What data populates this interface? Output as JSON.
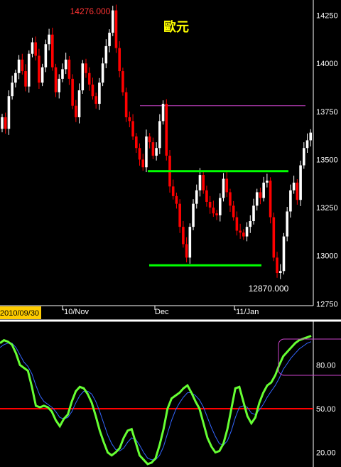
{
  "colors": {
    "background": "#000000",
    "up_candle": "#ffffff",
    "down_candle": "#ff0000",
    "support_resistance": "#00ff00",
    "target_line": "#cc44cc",
    "osc_main": "#66ff33",
    "osc_signal": "#3366ff",
    "osc_midline": "#ff0000",
    "date_box": "#ffcc00",
    "max_label": "#ff3333",
    "title": "#ffff00"
  },
  "chart_data": [
    {
      "type": "candlestick",
      "title": "歐元",
      "ylim": [
        12740,
        14330
      ],
      "y_ticks": [
        "14250",
        "14000",
        "13750",
        "13500",
        "13250",
        "13000",
        "12750"
      ],
      "x_ticks": [
        "'10/Nov",
        "Dec",
        "'11/Jan"
      ],
      "start_date_label": "2010/09/30",
      "max_label": "14276.000",
      "min_label": "12870.000",
      "resistance_level": 13440,
      "support_level": 12950,
      "target_level": 13780,
      "closes": [
        13720,
        13660,
        13830,
        13900,
        13950,
        14020,
        13960,
        13880,
        14050,
        14110,
        14040,
        13900,
        13980,
        14100,
        14150,
        13980,
        13850,
        13920,
        13970,
        14020,
        13920,
        13780,
        13720,
        13860,
        14000,
        13950,
        13890,
        13830,
        13790,
        13900,
        14000,
        14090,
        14160,
        14276,
        14080,
        13960,
        13850,
        13720,
        13700,
        13620,
        13560,
        13500,
        13460,
        13620,
        13590,
        13520,
        13560,
        13700,
        13790,
        13520,
        13360,
        13310,
        13270,
        13150,
        13060,
        12990,
        13150,
        13270,
        13340,
        13420,
        13340,
        13280,
        13250,
        13220,
        13210,
        13300,
        13400,
        13330,
        13260,
        13200,
        13130,
        13120,
        13100,
        13150,
        13180,
        13260,
        13330,
        13300,
        13380,
        13390,
        13200,
        12990,
        12910,
        12920,
        13100,
        13230,
        13340,
        13380,
        13290,
        13470,
        13560,
        13600,
        13640
      ]
    },
    {
      "type": "line",
      "ylim": [
        10,
        110
      ],
      "y_ticks": [
        "80.00",
        "50.00",
        "20.00"
      ],
      "reference_level": 50,
      "series": [
        {
          "values": [
            95,
            97,
            96,
            94,
            88,
            80,
            78,
            76,
            65,
            52,
            51,
            52,
            51,
            48,
            42,
            38,
            43,
            46,
            55,
            62,
            65,
            64,
            60,
            54,
            45,
            35,
            27,
            20,
            18,
            20,
            23,
            30,
            35,
            36,
            27,
            18,
            15,
            12,
            13,
            16,
            25,
            36,
            50,
            57,
            59,
            61,
            64,
            66,
            61,
            55,
            50,
            40,
            30,
            24,
            20,
            21,
            26,
            36,
            50,
            64,
            65,
            55,
            45,
            40,
            44,
            54,
            61,
            66,
            68,
            73,
            80,
            86,
            89,
            92,
            95,
            97,
            98,
            99,
            100
          ]
        },
        {
          "values": [
            92,
            94,
            95,
            95,
            92,
            87,
            82,
            79,
            74,
            66,
            59,
            55,
            53,
            51,
            48,
            44,
            43,
            44,
            48,
            54,
            59,
            62,
            62,
            60,
            55,
            48,
            40,
            32,
            26,
            22,
            21,
            23,
            27,
            30,
            29,
            25,
            20,
            16,
            15,
            15,
            18,
            24,
            33,
            42,
            49,
            54,
            58,
            61,
            61,
            59,
            56,
            51,
            44,
            37,
            31,
            26,
            25,
            28,
            35,
            44,
            51,
            52,
            51,
            47,
            46,
            49,
            53,
            58,
            62,
            66,
            71,
            77,
            81,
            85,
            88,
            91,
            93,
            95,
            96
          ]
        }
      ]
    }
  ]
}
